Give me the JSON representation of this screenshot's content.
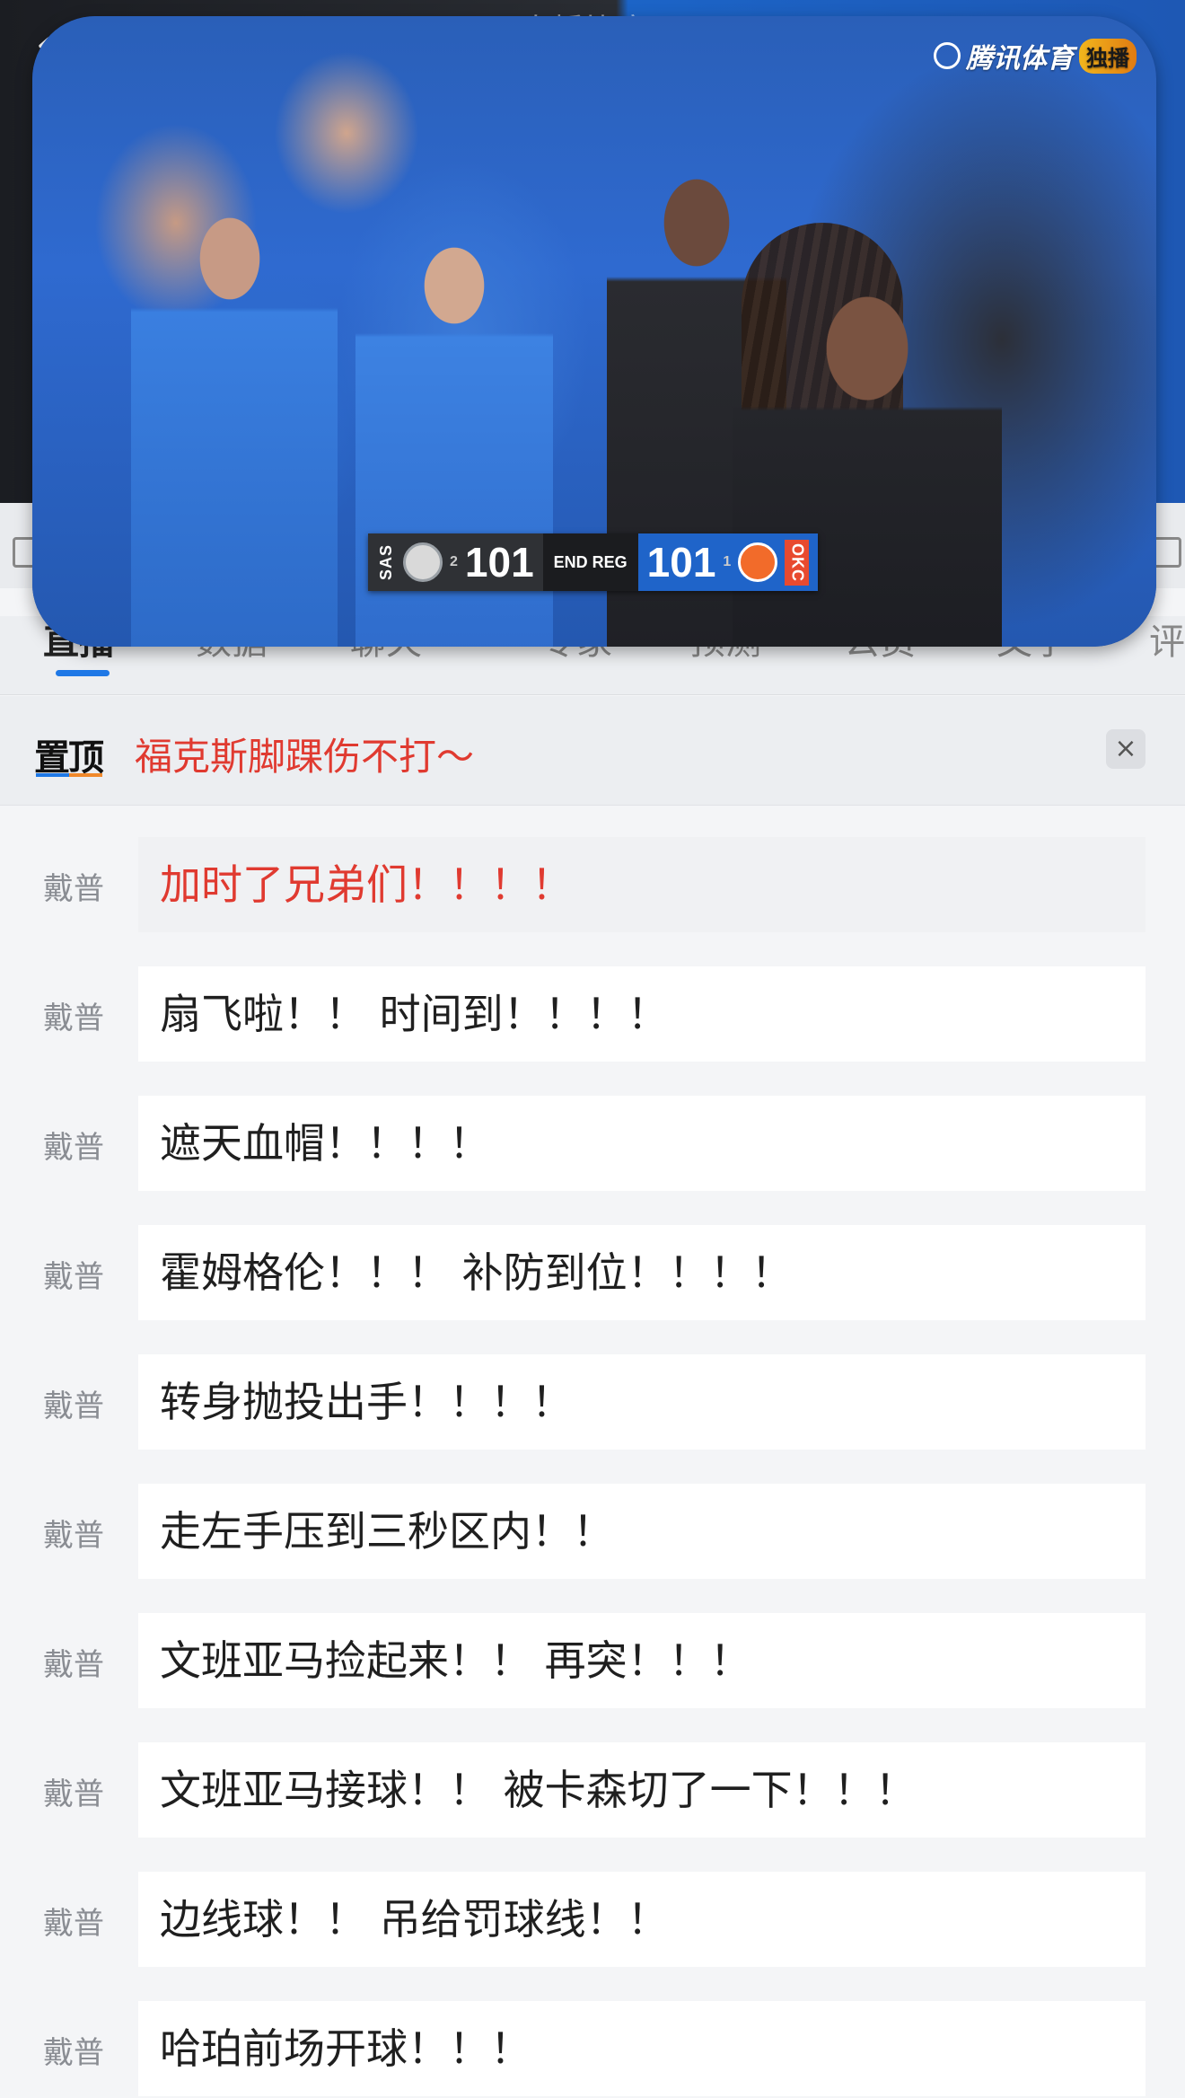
{
  "background_title": "直播比赛",
  "player": {
    "watermark_text": "腾讯体育",
    "watermark_badge": "独播",
    "scorebug": {
      "away_abbr": "SAS",
      "away_timeouts": "2",
      "away_score": "101",
      "status": "END REG",
      "home_score": "101",
      "home_timeouts": "1",
      "home_abbr": "OKC"
    }
  },
  "tabs": [
    {
      "label": "直播",
      "active": true
    },
    {
      "label": "数据"
    },
    {
      "label": "聊天"
    },
    {
      "label": "专家"
    },
    {
      "label": "预测"
    },
    {
      "label": "公员"
    },
    {
      "label": "文字"
    },
    {
      "label": "评"
    }
  ],
  "pinned": {
    "label": "置顶",
    "text": "福克斯脚踝伤不打～",
    "close_icon": "×"
  },
  "feed": [
    {
      "author": "戴普",
      "text": "加时了兄弟们！！！！",
      "highlight": true
    },
    {
      "author": "戴普",
      "text": "扇飞啦！！ 时间到！！！！"
    },
    {
      "author": "戴普",
      "text": "遮天血帽！！！！"
    },
    {
      "author": "戴普",
      "text": "霍姆格伦！！！ 补防到位！！！！"
    },
    {
      "author": "戴普",
      "text": "转身抛投出手！！！！"
    },
    {
      "author": "戴普",
      "text": "走左手压到三秒区内！！"
    },
    {
      "author": "戴普",
      "text": "文班亚马捡起来！！ 再突！！！"
    },
    {
      "author": "戴普",
      "text": "文班亚马接球！！ 被卡森切了一下！！！"
    },
    {
      "author": "戴普",
      "text": "边线球！！ 吊给罚球线！！"
    },
    {
      "author": "戴普",
      "text": "哈珀前场开球！！！"
    }
  ],
  "colors": {
    "accent_blue": "#1e78e6",
    "highlight_red": "#e03a30"
  }
}
